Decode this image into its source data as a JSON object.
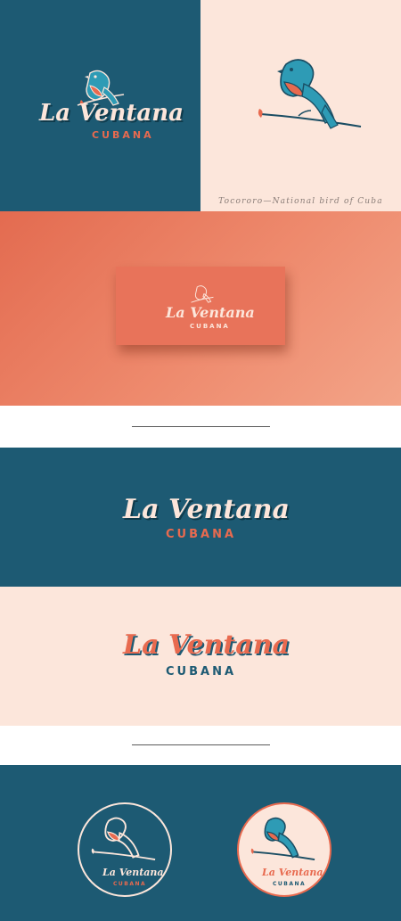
{
  "brand": {
    "name": "La Ventana",
    "subname": "CUBANA"
  },
  "bird_caption": "Tocororo—National bird of Cuba",
  "colors": {
    "teal": "#1d5a73",
    "cream": "#fce6db",
    "coral": "#e8735a",
    "bird_blue": "#2e9bb5"
  },
  "icons": [
    "tocororo-bird-icon",
    "leaf-icon",
    "branch-icon"
  ]
}
